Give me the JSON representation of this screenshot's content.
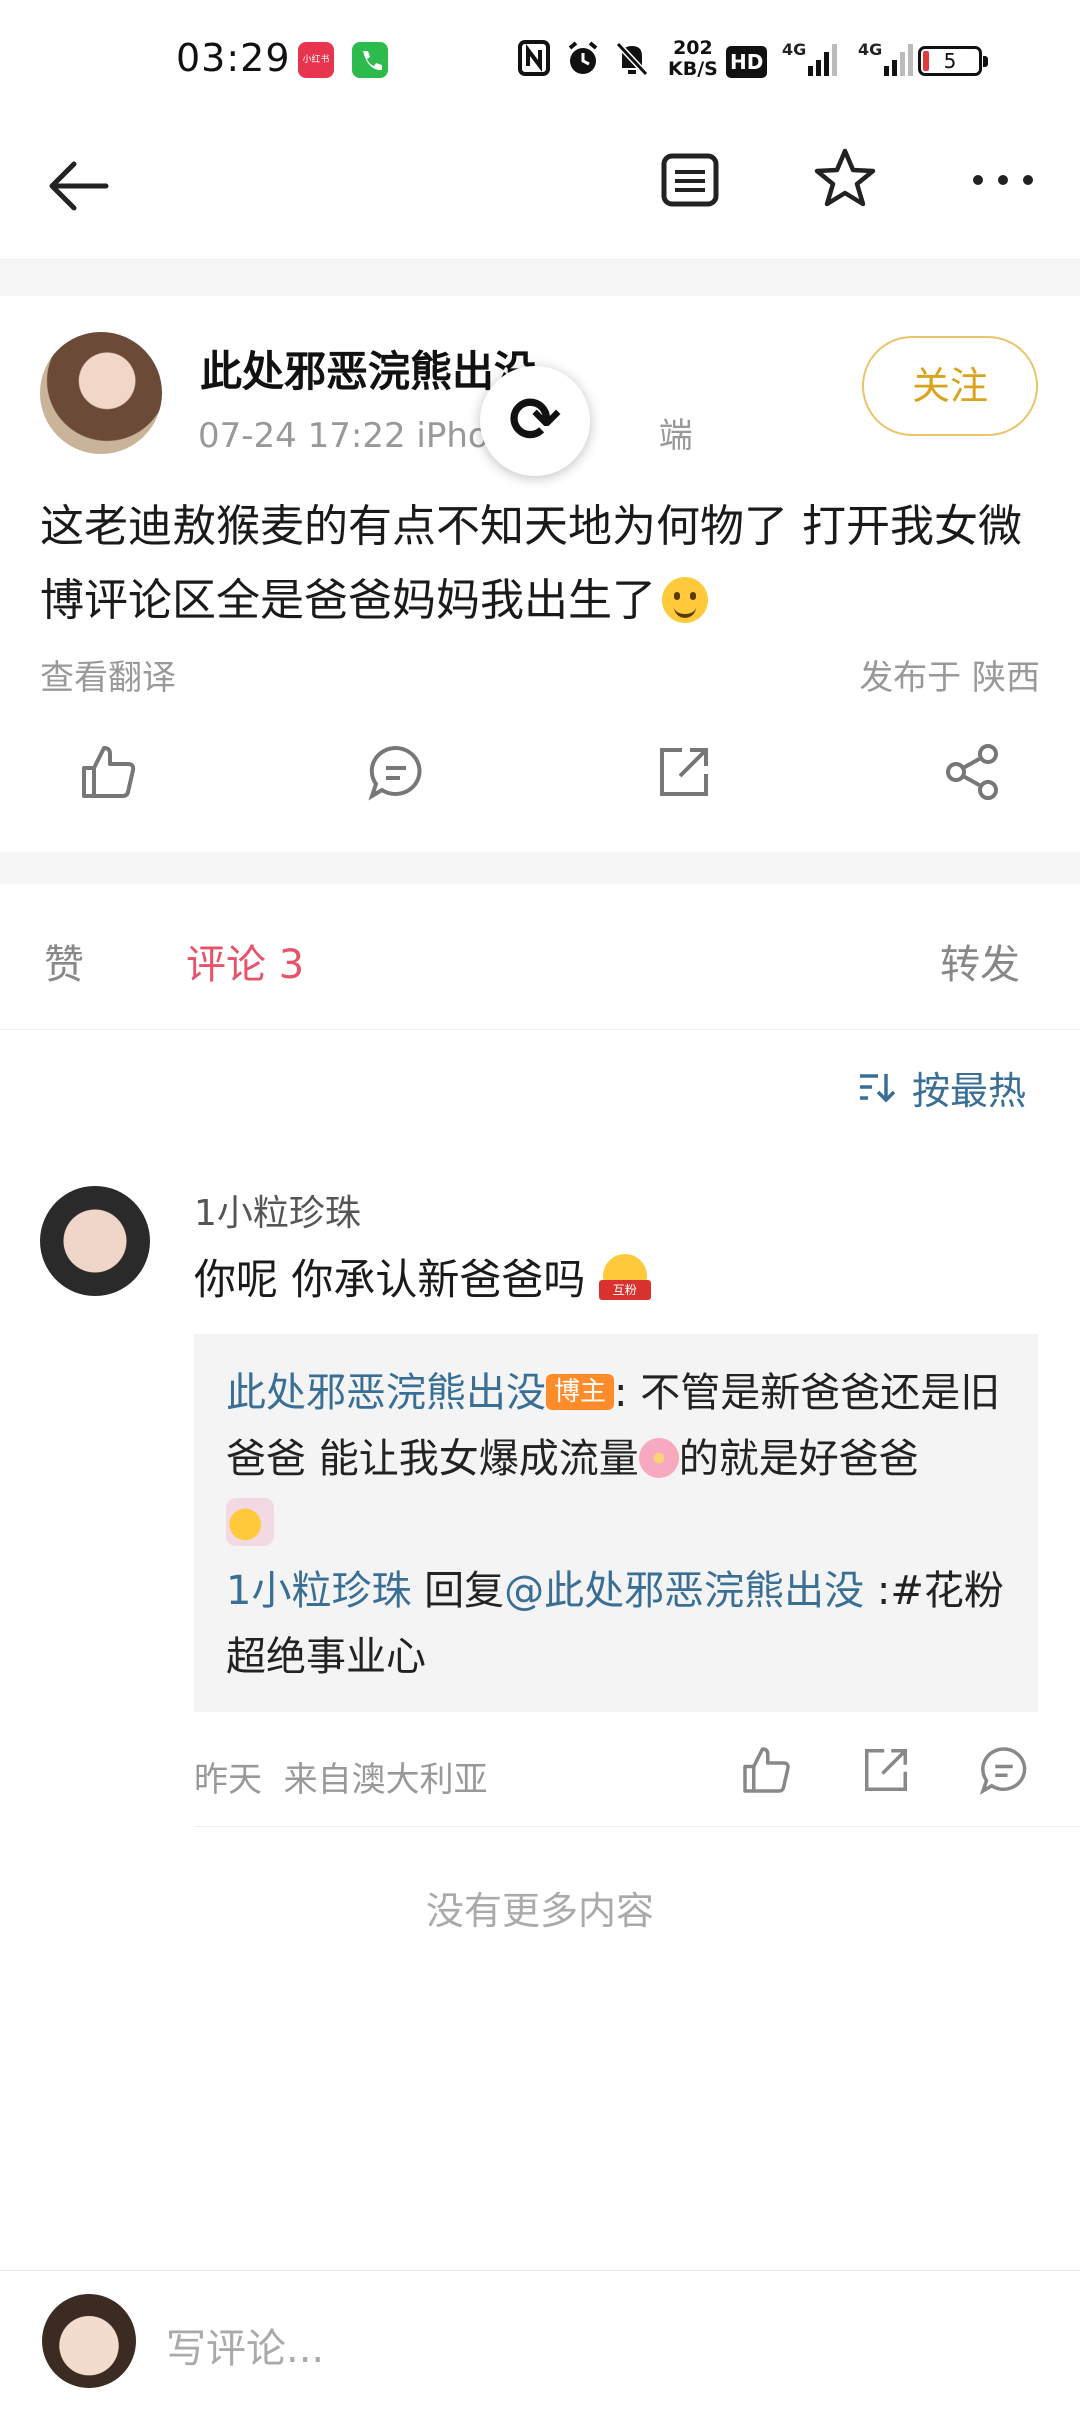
{
  "status_bar": {
    "time": "03:29",
    "app_chip_1_label": "小红书",
    "network_speed_value": "202",
    "network_speed_unit": "KB/S",
    "hd_label": "HD",
    "signal_1": "4G",
    "signal_2": "4G",
    "battery_level": "5",
    "colors": {
      "chip_red": "#e8344e",
      "chip_green": "#2dbb4e"
    }
  },
  "nav": {
    "icons": [
      "back-arrow-icon",
      "list-icon",
      "star-icon",
      "more-icon"
    ]
  },
  "post": {
    "username": "此处邪恶浣熊出没",
    "meta": "07-24 17:22  iPho",
    "meta_tail": "端",
    "follow_label": "关注",
    "text": "这老迪敖猴麦的有点不知天地为何物了 打开我女微博评论区全是爸爸妈妈我出生了",
    "translate_label": "查看翻译",
    "location": "发布于 陕西",
    "actions": [
      "like-icon",
      "comment-icon",
      "repost-icon",
      "share-icon"
    ]
  },
  "tabs": {
    "like_label": "赞",
    "comment_label": "评论 3",
    "repost_label": "转发",
    "active_color": "#e8536a"
  },
  "comments": {
    "sort_label": "按最热",
    "items": [
      {
        "user": "1小粒珍珠",
        "text": "你呢 你承认新爸爸吗",
        "emoji_tag": "互粉",
        "reply": {
          "author": "此处邪恶浣熊出没",
          "badge": "博主",
          "text_1": ": 不管是新爸爸还是旧爸爸 能让我女爆成流量",
          "text_2": "的就是好爸爸",
          "reply_user": "1小粒珍珠",
          "reply_verb": " 回复",
          "reply_target": "@此处邪恶浣熊出没",
          "reply_text": " :#花粉超绝事业心"
        },
        "time": "昨天",
        "source": "来自澳大利亚"
      }
    ],
    "no_more": "没有更多内容"
  },
  "bottom": {
    "placeholder": "写评论..."
  }
}
